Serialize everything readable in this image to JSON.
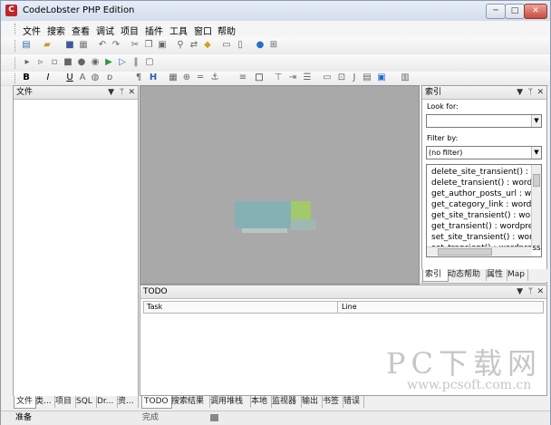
{
  "window": {
    "title": "CodeLobster PHP Edition",
    "app_icon_letter": "C",
    "controls": {
      "minimize": "─",
      "maximize": "□",
      "close": "✕"
    }
  },
  "menu": {
    "items": [
      "文件",
      "搜索",
      "查看",
      "调试",
      "项目",
      "插件",
      "工具",
      "窗口",
      "帮助"
    ]
  },
  "toolbars": {
    "main_icons": [
      "new-file-icon",
      "open-folder-icon",
      "save-icon",
      "save-all-icon",
      "print-icon",
      "undo-icon",
      "redo-icon",
      "cut-icon",
      "copy-icon",
      "paste-icon",
      "find-icon",
      "replace-icon",
      "find-in-files-icon",
      "toggle-view-icon",
      "toggle-view-2-icon",
      "help-icon",
      "settings-icon"
    ],
    "debug_icons": [
      "step-icon",
      "step-over-icon",
      "run-to-cursor-icon",
      "stop-icon",
      "watch-icon",
      "breakpoint-icon",
      "debug-run-icon",
      "run-icon",
      "pause-icon",
      "stop-debug-icon"
    ],
    "format_icons": [
      "bold-icon",
      "italic-icon",
      "underline-icon",
      "font-icon",
      "image-icon",
      "code-icon",
      "paragraph-icon",
      "heading-icon",
      "table-icon",
      "link-icon",
      "hr-icon",
      "anchor-icon",
      "list-icon",
      "box-icon",
      "align-icon",
      "indent-icon",
      "list-bullet-icon",
      "form-icon",
      "insert-icon",
      "object-icon",
      "script-icon",
      "text-icon",
      "frame-icon"
    ]
  },
  "file_panel": {
    "title": "文件",
    "controls": {
      "dropdown": "▼",
      "pin": "ᛘ",
      "close": "✕"
    },
    "tabs": [
      "文件",
      "类...",
      "项目",
      "SQL",
      "Dr...",
      "资..."
    ]
  },
  "index_panel": {
    "title": "索引",
    "controls": {
      "dropdown": "▼",
      "pin": "ᛘ",
      "close": "✕"
    },
    "look_for_label": "Look for:",
    "look_for_value": "",
    "filter_label": "Filter by:",
    "filter_value": "(no filter)",
    "results": [
      "delete_site_transient() : word",
      "delete_transient() : wordpre",
      "get_author_posts_url : word",
      "get_category_link : wordpr",
      "get_site_transient() : wordp",
      "get_transient() : wordpress",
      "set_site_transient() : wordp",
      "set_transient() : wordpress"
    ],
    "tabs": [
      "索引",
      "动态帮助",
      "属性",
      "Map"
    ]
  },
  "todo_panel": {
    "title": "TODO",
    "controls": {
      "dropdown": "▼",
      "pin": "ᛘ",
      "close": "✕"
    },
    "columns": [
      "Task",
      "Line"
    ],
    "tabs": [
      "TODO",
      "搜索结果",
      "调用堆栈",
      "本地",
      "监视器",
      "输出",
      "书签",
      "错误"
    ]
  },
  "statusbar": {
    "left": "准备",
    "middle": "完成"
  },
  "watermark": {
    "big": "PC下载网",
    "url": "www.pcsoft.com.cn"
  },
  "colors": {
    "editor_bg": "#a9a9a9",
    "splash_teal": "#7fb3b6",
    "splash_green": "#a2c96a",
    "title_gradient_top": "#e7eef8"
  }
}
